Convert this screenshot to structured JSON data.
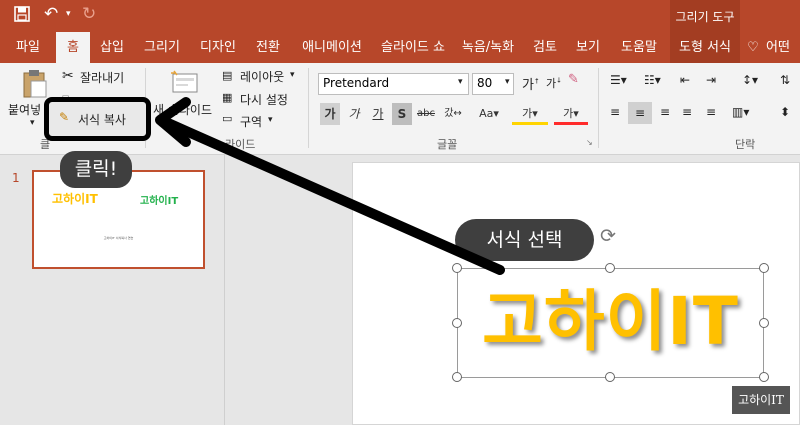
{
  "titlebar": {
    "tools_header": "그리기 도구"
  },
  "tabs": [
    "파일",
    "홈",
    "삽입",
    "그리기",
    "디자인",
    "전환",
    "애니메이션",
    "슬라이드 쇼",
    "녹음/녹화",
    "검토",
    "보기",
    "도움말",
    "도형 서식",
    "어떤"
  ],
  "ribbon": {
    "clipboard": {
      "paste": "붙여넣",
      "cut": "잘라내기",
      "format_painter": "서식 복사",
      "group": "클"
    },
    "slides": {
      "new_slide": "새 슬라이드",
      "layout": "레이아웃",
      "reset": "다시 설정",
      "section": "구역",
      "group": "라이드"
    },
    "font": {
      "name": "Pretendard",
      "size": "80",
      "group": "글꼴"
    },
    "paragraph": {
      "group": "단락"
    }
  },
  "thumbnail": {
    "number": "1",
    "title_left": "고하이IT",
    "title_right": "고하이IT",
    "caption": "고하이IT 서식복사 연습"
  },
  "slide": {
    "text": "고하이IT"
  },
  "annotations": {
    "click_bubble": "클릭!",
    "select_bubble": "서식 선택"
  },
  "watermark": "고하이IT",
  "colors": {
    "accent": "#b7472a",
    "yellow_text": "#ffc000",
    "thumb_green": "#22b14c",
    "arrow": "#000000"
  }
}
